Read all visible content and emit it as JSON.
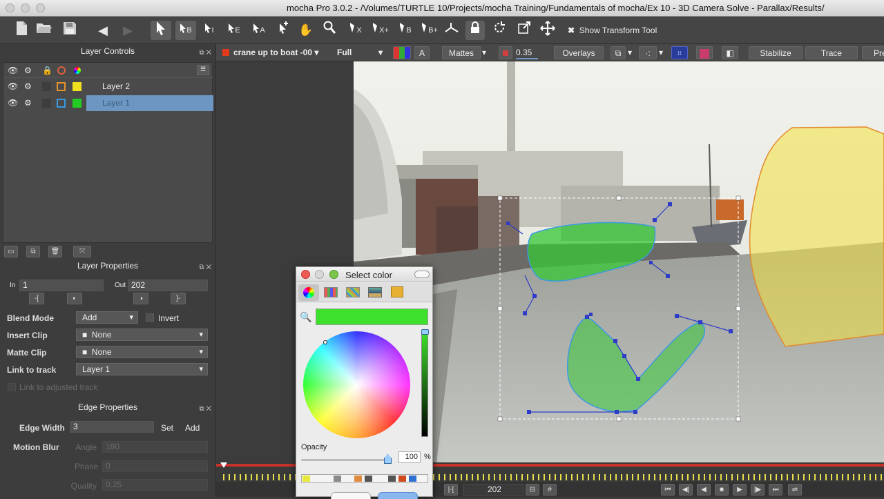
{
  "window": {
    "title": "mocha Pro 3.0.2 - /Volumes/TURTLE 10/Projects/mocha Training/Fundamentals of mocha/Ex 10 - 3D Camera Solve - Parallax/Results/"
  },
  "toolbar": {
    "show_transform_tool": "Show Transform Tool",
    "labels": [
      "B",
      "I",
      "E",
      "A",
      "X",
      "X+",
      "B",
      "B+"
    ]
  },
  "layer_controls": {
    "title": "Layer Controls",
    "layers": [
      {
        "name": "Layer 2",
        "outline_color": "#e8902a",
        "fill_color": "#f0e020"
      },
      {
        "name": "Layer 1",
        "outline_color": "#3a9ae0",
        "fill_color": "#22cc22"
      }
    ]
  },
  "layer_properties": {
    "title": "Layer Properties",
    "in_label": "In",
    "in_value": "1",
    "out_label": "Out",
    "out_value": "202",
    "blend_mode_label": "Blend Mode",
    "blend_mode_value": "Add",
    "invert_label": "Invert",
    "insert_clip_label": "Insert Clip",
    "insert_clip_value": "None",
    "matte_clip_label": "Matte Clip",
    "matte_clip_value": "None",
    "link_label": "Link to track",
    "link_value": "Layer 1",
    "link_adjusted": "Link to adjusted track"
  },
  "edge_properties": {
    "title": "Edge Properties",
    "edge_width_label": "Edge Width",
    "edge_width_value": "3",
    "set_label": "Set",
    "add_label": "Add",
    "motion_blur_label": "Motion Blur",
    "angle_label": "Angle",
    "angle_value": "180",
    "phase_label": "Phase",
    "phase_value": "0",
    "quality_label": "Quality",
    "quality_value": "0.25"
  },
  "viewer_toolbar": {
    "clip": "crane up to boat -00",
    "clip_color": "#e03a1a",
    "resolution": "Full",
    "a_label": "A",
    "mattes": "Mattes",
    "opacity": "0.35",
    "overlays": "Overlays",
    "stabilize": "Stabilize",
    "trace": "Trace",
    "pre": "Pre"
  },
  "timeline": {
    "frame": "202"
  },
  "select_color": {
    "title": "Select color",
    "color": "#3de02a",
    "opacity_label": "Opacity",
    "opacity_value": "100",
    "percent": "%",
    "swatches": [
      "#e8e83a",
      "#f4f4f4",
      "#d0d0d0",
      "#8a8a8a",
      "#e08a40",
      "#555555",
      "#f4f4f4",
      "#f4f4f4",
      "#555555",
      "#d04a20",
      "#3070d0",
      "#f4f4f4"
    ]
  }
}
